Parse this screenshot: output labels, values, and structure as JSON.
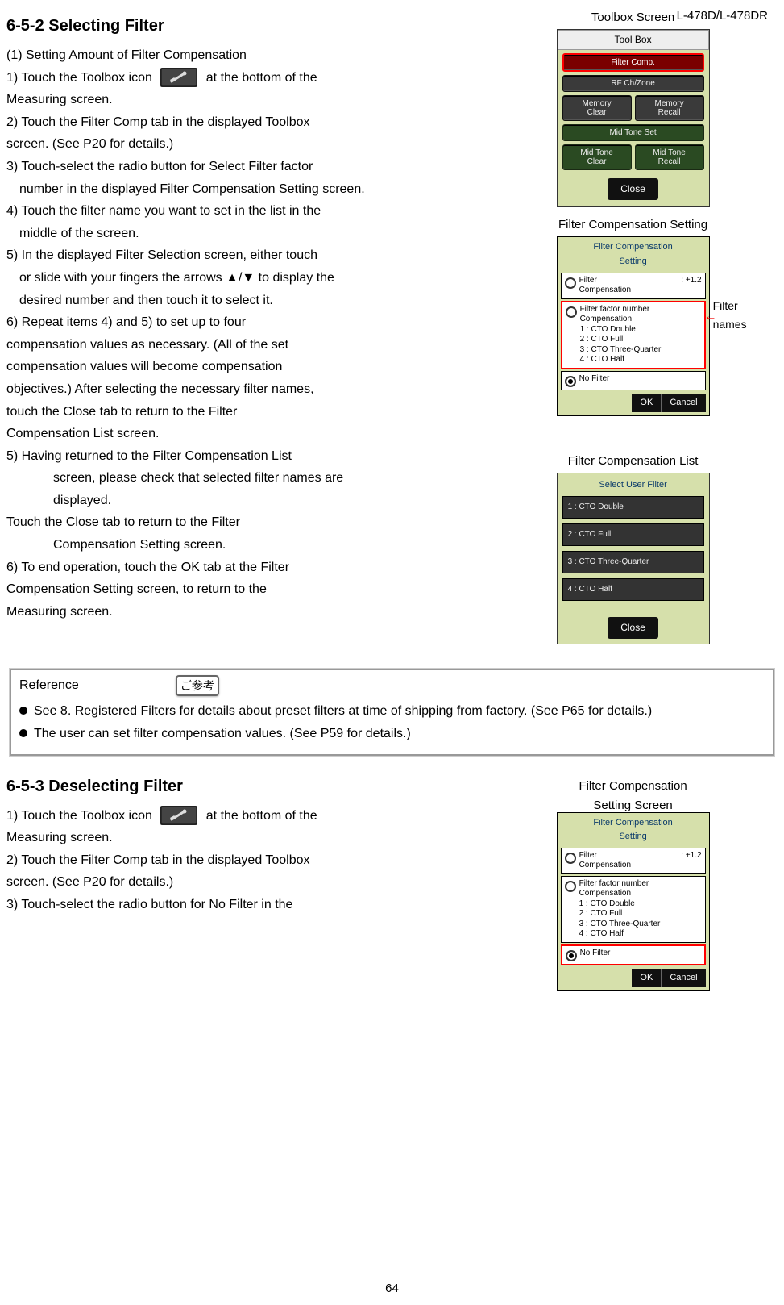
{
  "model": "L-478D/L-478DR",
  "page_number": "64",
  "section1": {
    "heading": "6-5-2 Selecting Filter",
    "sub": "(1) Setting Amount of Filter Compensation",
    "step1_a": "1)    Touch the Toolbox icon",
    "step1_b": "at the bottom of the",
    "step1_c": "Measuring screen.",
    "step2_a": "2)    Touch the Filter Comp tab in the displayed Toolbox",
    "step2_b": "screen. (See P20 for details.)",
    "step3_a": "3)          Touch-select the radio button for Select Filter factor",
    "step3_b": "number in the displayed Filter Compensation Setting screen.",
    "step4_a": "4)          Touch the filter name you want to set in the list in the",
    "step4_b": "middle of the screen.",
    "step5_a": "5)          In the displayed Filter Selection screen, either touch",
    "step5_b": "or slide with your fingers the arrows  ▲/▼  to display the",
    "step5_c": "desired number and then touch it to select it.",
    "step6_a": "6)    Repeat items 4) and 5) to set up to four",
    "step6_b": "compensation values as necessary. (All of the set",
    "step6_c": "compensation values will become compensation",
    "step6_d": "objectives.) After selecting the necessary filter names,",
    "step6_e": "touch the Close tab to return to the Filter",
    "step6_f": "Compensation List screen.",
    "step5x_a": "5)   Having returned to the Filter Compensation List",
    "step5x_b": "screen, please check that selected filter names are",
    "step5x_c": "displayed.",
    "step5x_d": "Touch the Close tab to return to the Filter",
    "step5x_e": "Compensation Setting screen.",
    "step6x_a": "6)    To end operation, touch the OK tab at the Filter",
    "step6x_b": "Compensation Setting screen, to return to the",
    "step6x_c": "Measuring screen."
  },
  "screens": {
    "toolbox_caption": "Toolbox Screen",
    "toolbox_title": "Tool Box",
    "toolbox_buttons": {
      "filter_comp": "Filter Comp.",
      "rf": "RF Ch/Zone",
      "mem_clear": "Memory\nClear",
      "mem_recall": "Memory\nRecall",
      "mid_tone_set": "Mid Tone Set",
      "mid_clear": "Mid Tone\nClear",
      "mid_recall": "Mid Tone\nRecall",
      "close": "Close"
    },
    "setting_caption": "Filter Compensation Setting",
    "setting_title": "Filter Compensation\nSetting",
    "setting_opt1_label": "Filter\nCompensation",
    "setting_opt1_val": ": +1.2",
    "setting_opt2_label": "Filter factor number\nCompensation",
    "setting_opt2_items": "1 : CTO Double\n2 : CTO Full\n3 : CTO Three-Quarter\n4 : CTO Half",
    "setting_opt3": "No Filter",
    "ok": "OK",
    "cancel": "Cancel",
    "filter_names_label": "Filter\nnames",
    "list_caption": "Filter Compensation List",
    "list_title": "Select  User  Filter",
    "list_items": [
      "1 : CTO Double",
      "2 : CTO Full",
      "3 : CTO Three-Quarter",
      "4 : CTO Half"
    ],
    "list_close": "Close",
    "setting2_caption": "Filter Compensation\nSetting Screen"
  },
  "reference": {
    "title": "Reference",
    "badge": "ご参考",
    "b1": "See 8. Registered Filters for details about preset filters at time of shipping from factory. (See P65 for details.)",
    "b2": "The user can set filter compensation values. (See P59 for details.)"
  },
  "section2": {
    "heading": "6-5-3 Deselecting Filter",
    "s1a": "1)    Touch the Toolbox icon",
    "s1b": "at the bottom of the",
    "s1c": "Measuring screen.",
    "s2a": "2)    Touch the Filter Comp tab in the displayed Toolbox",
    "s2b": "screen. (See P20 for details.)",
    "s3a": "3)    Touch-select the radio button for No Filter in the"
  }
}
